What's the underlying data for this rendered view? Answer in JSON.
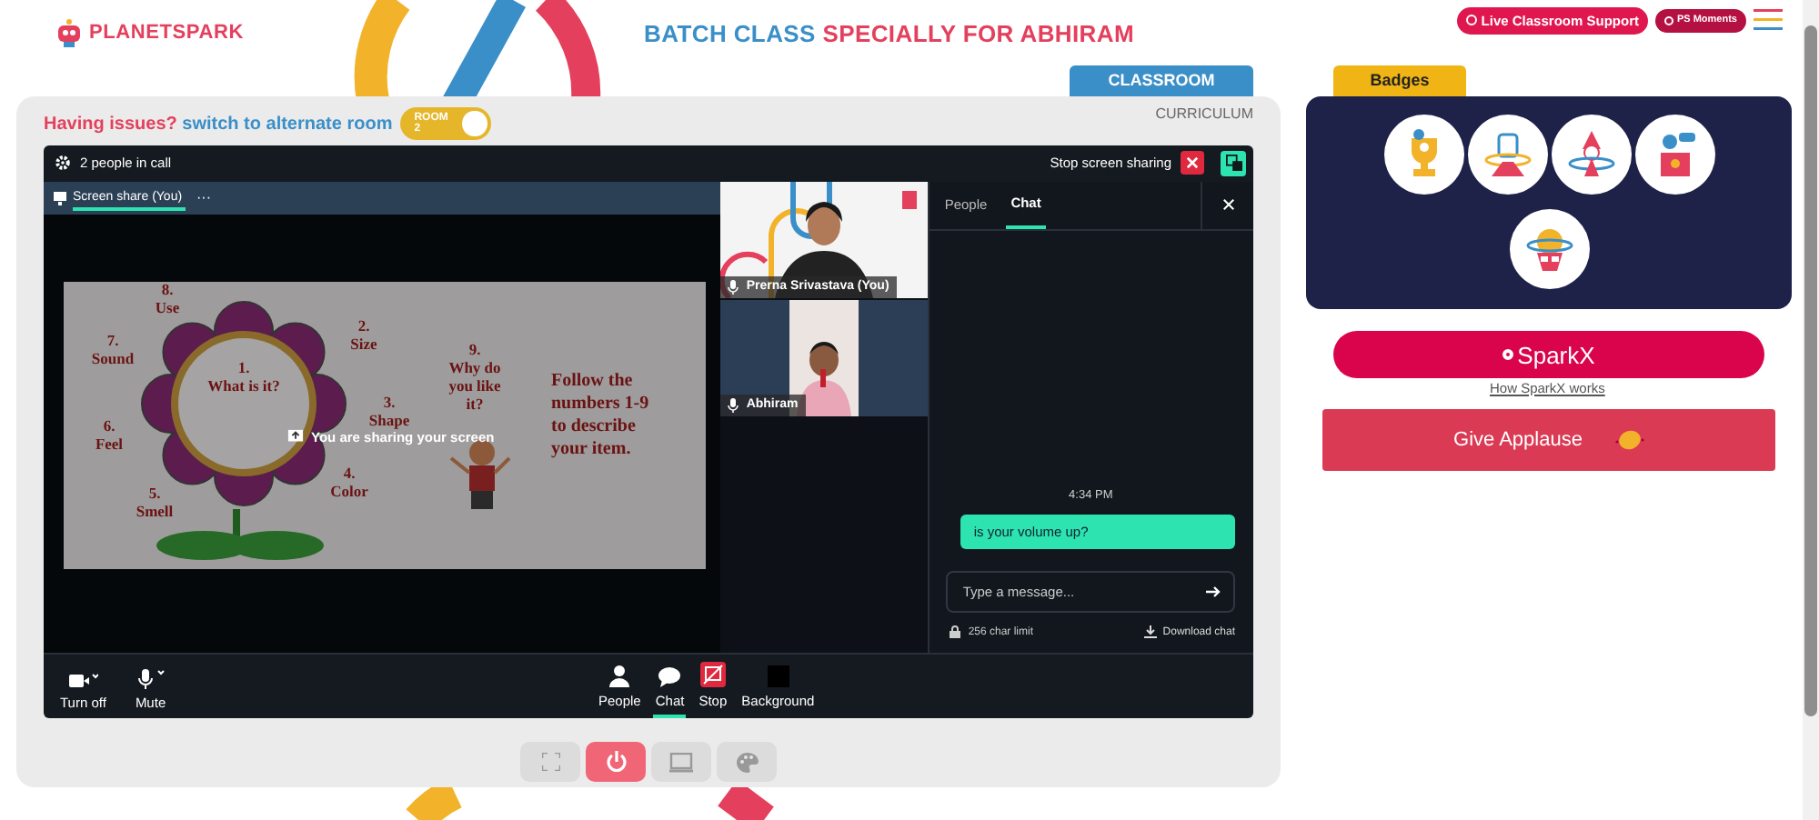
{
  "header": {
    "logo": "PLANETSPARK",
    "title_lead": "BATCH CLASS",
    "title_highlight": "SPECIALLY FOR ABHIRAM",
    "support_button": "Live Classroom Support",
    "moments_button": "PS Moments"
  },
  "classroom_tabs": [
    {
      "label": "CLASSROOM",
      "selected": true
    },
    {
      "label": "CURRICULUM",
      "selected": false
    }
  ],
  "issue_bar": {
    "question": "Having issues?",
    "link": "switch to alternate room",
    "toggle": {
      "label": "ROOM 2",
      "on": true
    }
  },
  "call": {
    "people_count": "2 people in call",
    "stop_sharing": "Stop screen sharing",
    "stage_tab": "Screen share (You)",
    "stage_menu": "···",
    "sharing_notice": "You are sharing your screen",
    "slide": {
      "labels": [
        {
          "lines": [
            "8.",
            "Use"
          ]
        },
        {
          "lines": [
            "7.",
            "Sound"
          ]
        },
        {
          "lines": [
            "2.",
            "Size"
          ]
        },
        {
          "lines": [
            "1.",
            "What is it?"
          ]
        },
        {
          "lines": [
            "3.",
            "Shape"
          ]
        },
        {
          "lines": [
            "6.",
            "Feel"
          ]
        },
        {
          "lines": [
            "4.",
            "Color"
          ]
        },
        {
          "lines": [
            "5.",
            "Smell"
          ]
        },
        {
          "lines": [
            "9.",
            "Why do",
            "you like",
            "it?"
          ]
        }
      ],
      "instruction": [
        "Follow the",
        "numbers 1-9",
        "to describe",
        "your item."
      ]
    },
    "participants": [
      {
        "name": "Prerna Srivastava (You)",
        "kind": "teacher"
      },
      {
        "name": "Abhiram",
        "kind": "student"
      }
    ],
    "chat": {
      "tabs": [
        {
          "label": "People",
          "selected": false
        },
        {
          "label": "Chat",
          "selected": true
        }
      ],
      "time": "4:34 PM",
      "messages": [
        "is your volume up?"
      ],
      "placeholder": "Type a message...",
      "limit": "256 char limit",
      "download": "Download chat"
    },
    "toolbar_left": [
      {
        "label": "Turn off",
        "kind": "camera"
      },
      {
        "label": "Mute",
        "kind": "mic"
      }
    ],
    "toolbar_center": [
      {
        "label": "People",
        "kind": "people",
        "selected": false
      },
      {
        "label": "Chat",
        "kind": "chat",
        "selected": true
      },
      {
        "label": "Stop",
        "kind": "stop",
        "selected": false
      },
      {
        "label": "Background",
        "kind": "background",
        "selected": false
      }
    ]
  },
  "room_controls": [
    {
      "kind": "fullscreen",
      "selected": false
    },
    {
      "kind": "power",
      "selected": true
    },
    {
      "kind": "screen",
      "selected": false
    },
    {
      "kind": "palette",
      "selected": false
    }
  ],
  "badges_tab": "Badges",
  "sparkx": {
    "button": "SparkX",
    "link": "How SparkX works"
  },
  "applause": "Give Applause"
}
